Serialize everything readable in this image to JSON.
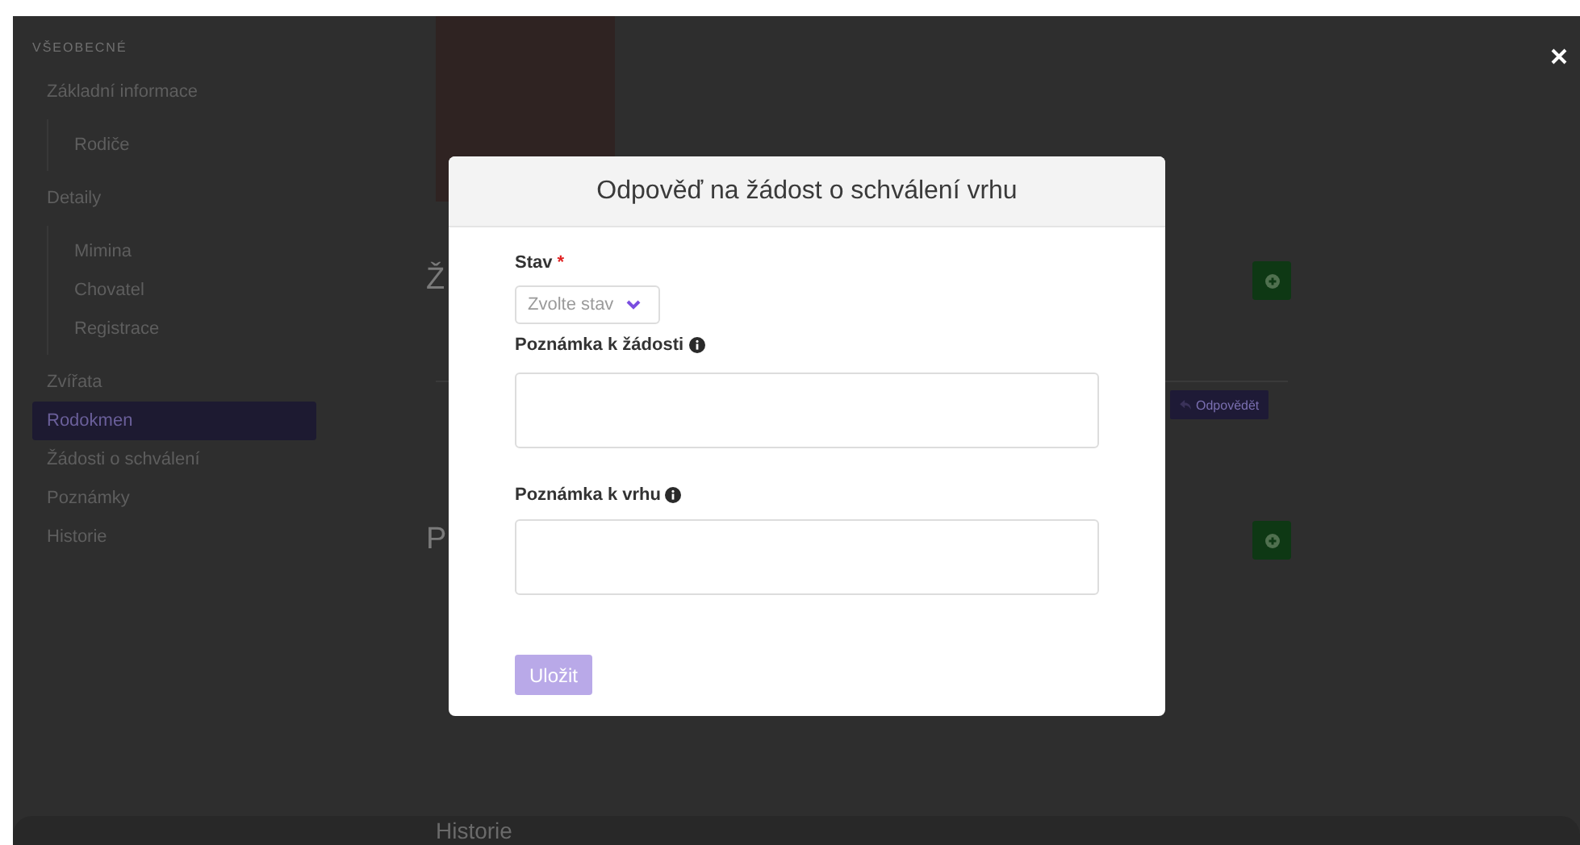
{
  "sidebar": {
    "section": "VŠEOBECNÉ",
    "items": [
      {
        "label": "Základní informace",
        "selected": false,
        "children": [
          {
            "label": "Rodiče",
            "selected": false
          }
        ]
      },
      {
        "label": "Detaily",
        "selected": false,
        "children": [
          {
            "label": "Mimina",
            "selected": false
          },
          {
            "label": "Chovatel",
            "selected": false
          },
          {
            "label": "Registrace",
            "selected": false
          }
        ]
      },
      {
        "label": "Zvířata",
        "selected": false
      },
      {
        "label": "Rodokmen",
        "selected": true
      },
      {
        "label": "Žádosti o schválení",
        "selected": false
      },
      {
        "label": "Poznámky",
        "selected": false
      },
      {
        "label": "Historie",
        "selected": false
      }
    ]
  },
  "page": {
    "sections": [
      {
        "heading": "Ž",
        "reply_button": "Odpovědět"
      },
      {
        "heading": "P"
      }
    ],
    "bottom_heading": "Historie"
  },
  "modal": {
    "title": "Odpověď na žádost o schválení vrhu",
    "fields": [
      {
        "kind": "select",
        "label": "Stav",
        "required_mark": "*",
        "placeholder": "Zvolte stav"
      },
      {
        "kind": "textarea",
        "label": "Poznámka k žádosti",
        "info": true
      },
      {
        "kind": "textarea",
        "label": "Poznámka k vrhu",
        "info": true
      }
    ],
    "save_button": {
      "label": "Uložit",
      "disabled": true
    }
  }
}
